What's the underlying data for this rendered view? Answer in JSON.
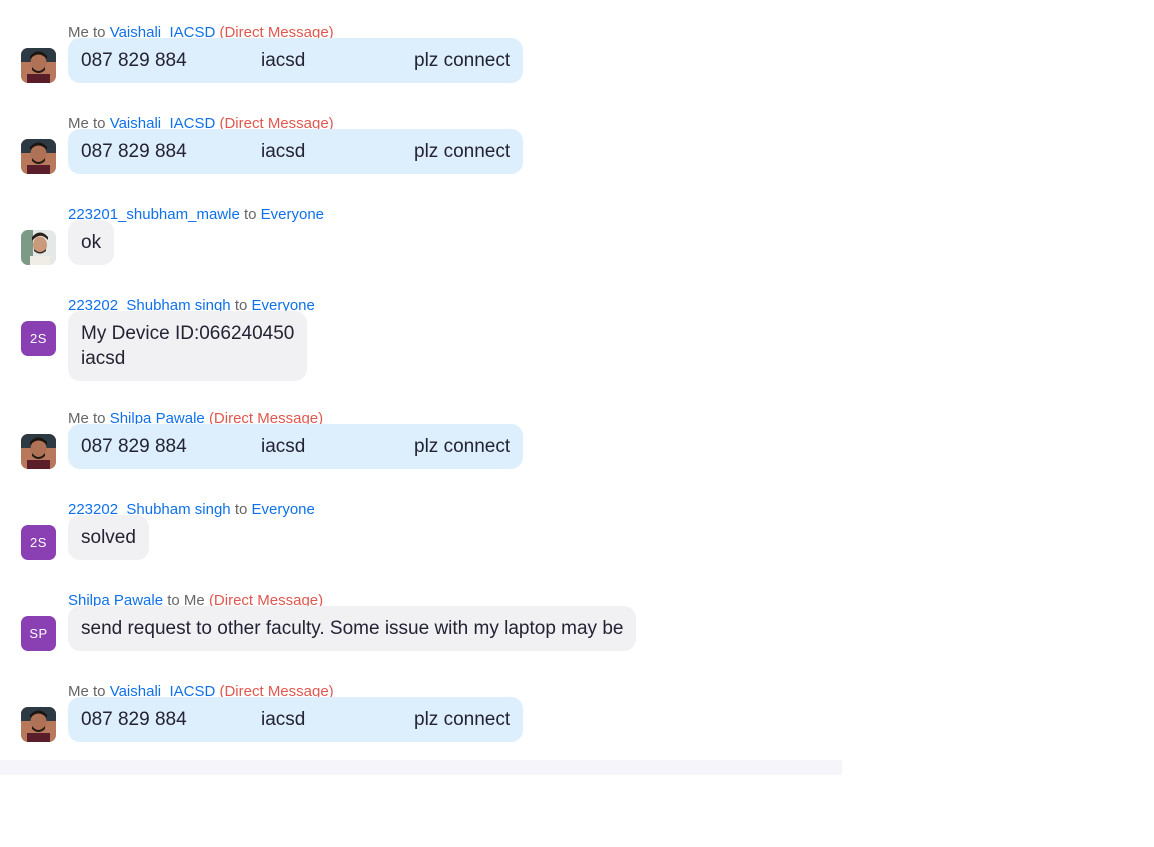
{
  "messages": [
    {
      "sender": "Me",
      "to_word": "to",
      "recipient": "Vaishali_IACSD",
      "tag": "(Direct Message)",
      "avatar": "photo-avatar-me",
      "mine": true,
      "segments": [
        "087 829 884",
        "iacsd",
        "plz connect"
      ]
    },
    {
      "sender": "Me",
      "to_word": "to",
      "recipient": "Vaishali_IACSD",
      "tag": "(Direct Message)",
      "avatar": "photo-avatar-me",
      "mine": true,
      "segments": [
        "087 829 884",
        "iacsd",
        "plz connect"
      ]
    },
    {
      "sender": "223201_shubham_mawle",
      "to_word": "to",
      "recipient": "Everyone",
      "tag": "",
      "avatar": "photo-avatar-shubham-mawle",
      "mine": false,
      "lines": [
        "ok"
      ]
    },
    {
      "sender": "223202_Shubham singh",
      "to_word": "to",
      "recipient": "Everyone",
      "tag": "",
      "avatar_initials": "2S",
      "mine": false,
      "lines": [
        "My Device ID:066240450",
        "iacsd"
      ]
    },
    {
      "sender": "Me",
      "to_word": "to",
      "recipient": "Shilpa Pawale",
      "tag": "(Direct Message)",
      "avatar": "photo-avatar-me",
      "mine": true,
      "segments": [
        "087 829 884",
        "iacsd",
        "plz connect"
      ]
    },
    {
      "sender": "223202_Shubham singh",
      "to_word": "to",
      "recipient": "Everyone",
      "tag": "",
      "avatar_initials": "2S",
      "mine": false,
      "lines": [
        "solved"
      ]
    },
    {
      "sender": "Shilpa Pawale",
      "to_word": "to",
      "recipient": "Me",
      "tag": "(Direct Message)",
      "avatar_initials": "SP",
      "mine": false,
      "lines": [
        "send request to other faculty. Some issue with my laptop may be"
      ]
    },
    {
      "sender": "Me",
      "to_word": "to",
      "recipient": "Vaishali_IACSD",
      "tag": "(Direct Message)",
      "avatar": "photo-avatar-me",
      "mine": true,
      "segments": [
        "087 829 884",
        "iacsd",
        "plz connect"
      ]
    }
  ],
  "colors": {
    "accent_blue": "#0e71eb",
    "direct_message_red": "#e0574f",
    "mine_bubble": "#ddeefc",
    "theirs_bubble": "#f1f1f4",
    "initials_avatar": "#8a3fb3"
  }
}
